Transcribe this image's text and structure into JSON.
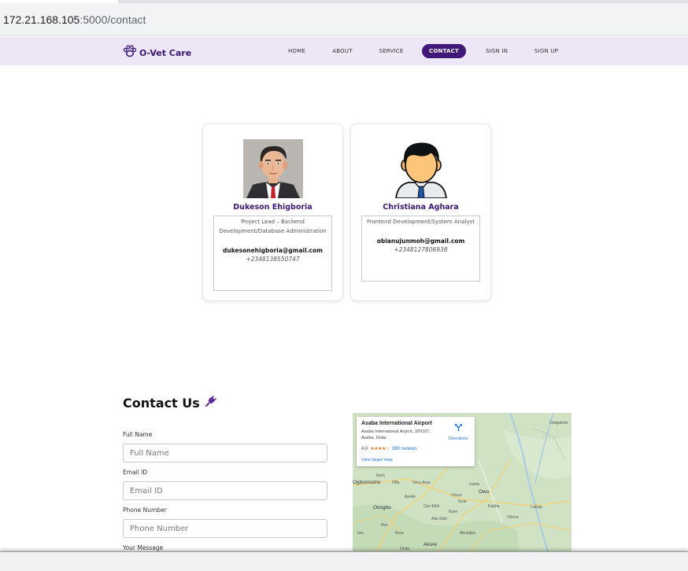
{
  "browser": {
    "url_host": "172.21.168.105",
    "url_path": ":5000/contact"
  },
  "navbar": {
    "brand": "O-Vet Care",
    "items": [
      {
        "label": "HOME",
        "active": false
      },
      {
        "label": "ABOUT",
        "active": false
      },
      {
        "label": "SERVICE",
        "active": false
      },
      {
        "label": "CONTACT",
        "active": true
      },
      {
        "label": "SIGN IN",
        "active": false
      },
      {
        "label": "SIGN UP",
        "active": false
      }
    ]
  },
  "team": [
    {
      "name": "Dukeson Ehigboria",
      "role": "Project Lead – Backend Development/Database Administration",
      "email": "dukesonehigboria@gmail.com",
      "phone": "+2348138550747"
    },
    {
      "name": "Christiana Aghara",
      "role": "Frontend Development/System Analyst",
      "email": "obianujunmoh@gmail.com",
      "phone": "+2348127806938"
    }
  ],
  "contact": {
    "title": "Contact Us",
    "fields": [
      {
        "label": "Full Name",
        "placeholder": "Full Name"
      },
      {
        "label": "Email ID",
        "placeholder": "Email ID"
      },
      {
        "label": "Phone Number",
        "placeholder": "Phone Number"
      }
    ],
    "message_label": "Your Message"
  },
  "map": {
    "place": "Asaba International Airport",
    "address": "Asaba International Airport, 320107, Asaba, Delta",
    "rating": "4.0",
    "stars": "★★★★☆",
    "reviews": "389 reviews",
    "directions": "Directions",
    "larger_map": "View larger map",
    "labels": {
      "l1": "Owigabele",
      "l2": "Owo",
      "l3": "Akure",
      "l4": "Osogbo",
      "l5": "Ondo",
      "l6": "Ikare",
      "l7": "Kabba",
      "l8": "Lokoja",
      "l9": "Omuo",
      "l10": "Okene",
      "l11": "Ado Ekiti",
      "l12": "Ilesa",
      "l13": "Isanlu",
      "l14": "Ikole",
      "l15": "Ilorin",
      "l16": "Ogbomosho",
      "l17": "Offa",
      "l18": "Omu Aran",
      "l19": "Oyo Ekiti",
      "l20": "Ayede",
      "l21": "Iwo",
      "l22": "Akungba",
      "l23": "Ifon"
    },
    "colors": {
      "land": "#cfe3c4",
      "road": "#f2d27a",
      "water": "#a9cbe4"
    }
  }
}
